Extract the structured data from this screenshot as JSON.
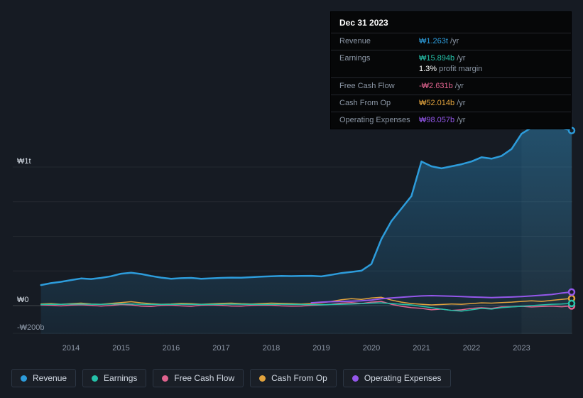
{
  "colors": {
    "revenue": "#2d9cdb",
    "earnings": "#25c1a9",
    "free_cash_flow": "#e0638f",
    "cash_from_op": "#e2a33d",
    "operating_expenses": "#9457eb",
    "background": "#161b23",
    "tooltip_bg": "#060708",
    "muted_text": "#8b96a5"
  },
  "tooltip": {
    "date": "Dec 31 2023",
    "rows": [
      {
        "label": "Revenue",
        "value": "₩1.263t",
        "suffix": " /yr"
      },
      {
        "label": "Earnings",
        "value": "₩15.894b",
        "suffix": " /yr",
        "extra_value": "1.3%",
        "extra_label": " profit margin"
      },
      {
        "label": "Free Cash Flow",
        "value": "-₩2.631b",
        "suffix": " /yr"
      },
      {
        "label": "Cash From Op",
        "value": "₩52.014b",
        "suffix": " /yr"
      },
      {
        "label": "Operating Expenses",
        "value": "₩98.057b",
        "suffix": " /yr"
      }
    ]
  },
  "y_axis": {
    "labels": [
      {
        "text": "₩1t",
        "value": 1000,
        "muted": false
      },
      {
        "text": "₩0",
        "value": 0,
        "muted": false
      },
      {
        "text": "-₩200b",
        "value": -200,
        "muted": true
      }
    ]
  },
  "x_axis": {
    "years": [
      2014,
      2015,
      2016,
      2017,
      2018,
      2019,
      2020,
      2021,
      2022,
      2023
    ]
  },
  "legend": [
    {
      "label": "Revenue",
      "color_key": "revenue"
    },
    {
      "label": "Earnings",
      "color_key": "earnings"
    },
    {
      "label": "Free Cash Flow",
      "color_key": "free_cash_flow"
    },
    {
      "label": "Cash From Op",
      "color_key": "cash_from_op"
    },
    {
      "label": "Operating Expenses",
      "color_key": "operating_expenses"
    }
  ],
  "chart_data": {
    "type": "line",
    "title": "Revenue & Expenses History (₩, billions)",
    "units": "KRW billions",
    "ylim": [
      -200,
      1400
    ],
    "y_gridlines": [
      1000,
      750,
      500,
      250,
      0,
      -200
    ],
    "x": [
      2013.4,
      2013.6,
      2013.8,
      2014.0,
      2014.2,
      2014.4,
      2014.6,
      2014.8,
      2015.0,
      2015.2,
      2015.4,
      2015.6,
      2015.8,
      2016.0,
      2016.2,
      2016.4,
      2016.6,
      2016.8,
      2017.0,
      2017.2,
      2017.4,
      2017.6,
      2017.8,
      2018.0,
      2018.2,
      2018.4,
      2018.6,
      2018.8,
      2019.0,
      2019.2,
      2019.4,
      2019.6,
      2019.8,
      2020.0,
      2020.2,
      2020.4,
      2020.6,
      2020.8,
      2021.0,
      2021.2,
      2021.4,
      2021.6,
      2021.8,
      2022.0,
      2022.2,
      2022.4,
      2022.6,
      2022.8,
      2023.0,
      2023.2,
      2023.4,
      2023.6,
      2023.8,
      2024.0
    ],
    "series": [
      {
        "name": "Revenue",
        "color_key": "revenue",
        "width": 2.5,
        "fill": true,
        "values": [
          148,
          162,
          172,
          184,
          196,
          192,
          200,
          212,
          230,
          237,
          228,
          214,
          202,
          194,
          198,
          200,
          194,
          197,
          200,
          202,
          201,
          205,
          209,
          212,
          214,
          213,
          214,
          215,
          211,
          222,
          235,
          243,
          252,
          300,
          480,
          610,
          700,
          790,
          1040,
          1005,
          990,
          1005,
          1020,
          1040,
          1070,
          1060,
          1080,
          1130,
          1240,
          1285,
          1290,
          1288,
          1282,
          1263
        ]
      },
      {
        "name": "Cash From Op",
        "color_key": "cash_from_op",
        "width": 1.5,
        "values": [
          12,
          15,
          10,
          14,
          18,
          12,
          10,
          16,
          22,
          28,
          20,
          14,
          10,
          12,
          16,
          14,
          10,
          13,
          16,
          18,
          14,
          12,
          15,
          18,
          16,
          14,
          12,
          15,
          20,
          30,
          42,
          50,
          45,
          55,
          60,
          40,
          25,
          15,
          10,
          5,
          8,
          12,
          10,
          15,
          20,
          18,
          22,
          25,
          30,
          35,
          30,
          38,
          45,
          52.014
        ]
      },
      {
        "name": "Free Cash Flow",
        "color_key": "free_cash_flow",
        "width": 1.5,
        "values": [
          5,
          3,
          -2,
          4,
          6,
          2,
          -3,
          1,
          8,
          5,
          -4,
          -6,
          2,
          4,
          -2,
          -5,
          3,
          5,
          2,
          -3,
          -4,
          2,
          4,
          3,
          -2,
          -4,
          -3,
          2,
          5,
          10,
          18,
          22,
          15,
          25,
          30,
          10,
          -5,
          -15,
          -20,
          -30,
          -25,
          -35,
          -30,
          -20,
          -15,
          -20,
          -10,
          -8,
          -5,
          -10,
          -6,
          -4,
          -8,
          -2.631
        ]
      },
      {
        "name": "Earnings",
        "color_key": "earnings",
        "width": 1.5,
        "values": [
          8,
          10,
          9,
          11,
          12,
          10,
          9,
          11,
          13,
          12,
          10,
          9,
          8,
          9,
          10,
          9,
          8,
          9,
          10,
          11,
          10,
          9,
          8,
          9,
          10,
          9,
          8,
          7,
          6,
          8,
          10,
          12,
          14,
          18,
          20,
          15,
          10,
          5,
          -5,
          -15,
          -25,
          -35,
          -40,
          -30,
          -20,
          -25,
          -15,
          -10,
          -5,
          0,
          5,
          10,
          12,
          15.894
        ]
      },
      {
        "name": "Operating Expenses",
        "color_key": "operating_expenses",
        "width": 2,
        "values": [
          null,
          null,
          null,
          null,
          null,
          null,
          null,
          null,
          null,
          null,
          null,
          null,
          null,
          null,
          null,
          null,
          null,
          null,
          null,
          null,
          null,
          null,
          null,
          null,
          null,
          null,
          null,
          20,
          25,
          28,
          30,
          32,
          35,
          40,
          50,
          55,
          60,
          65,
          70,
          72,
          70,
          68,
          65,
          62,
          60,
          58,
          60,
          62,
          65,
          70,
          75,
          80,
          90,
          98.057
        ]
      }
    ]
  }
}
